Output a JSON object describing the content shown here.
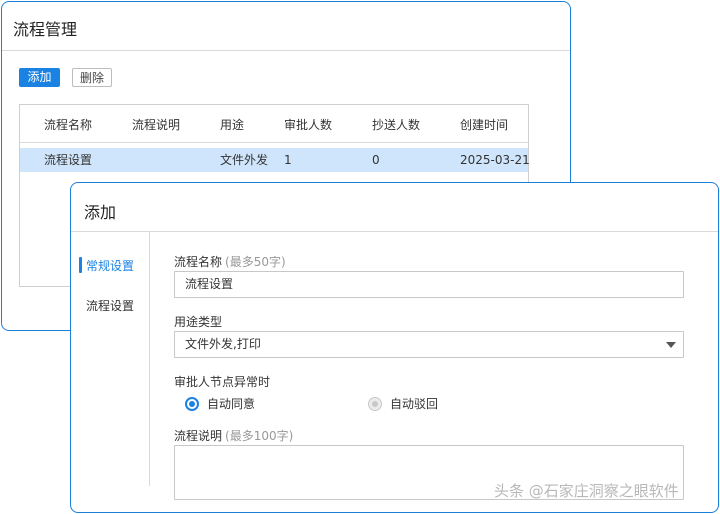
{
  "back_window": {
    "title": "流程管理",
    "toolbar": {
      "add_label": "添加",
      "delete_label": "删除"
    },
    "table": {
      "columns": [
        "流程名称",
        "流程说明",
        "用途",
        "审批人数",
        "抄送人数",
        "创建时间"
      ],
      "rows": [
        [
          "流程设置",
          "",
          "文件外发",
          "1",
          "0",
          "2025-03-21"
        ]
      ]
    }
  },
  "dialog": {
    "title": "添加",
    "nav": {
      "items": [
        "常规设置",
        "流程设置"
      ],
      "active": "常规设置"
    },
    "form": {
      "name_label": "流程名称",
      "name_hint": "(最多50字)",
      "name_value": "流程设置",
      "usage_label": "用途类型",
      "usage_value": "文件外发,打印",
      "abnormal_label": "审批人节点异常时",
      "radio_agree": "自动同意",
      "radio_reject": "自动驳回",
      "radio_selected": "自动同意",
      "desc_label": "流程说明",
      "desc_hint": "(最多100字)",
      "desc_value": ""
    }
  },
  "watermark": "头条 @石家庄洞察之眼软件",
  "colors": {
    "accent": "#1a82e2",
    "selected_row": "#cfe5fb",
    "border": "#c8c8c8"
  }
}
